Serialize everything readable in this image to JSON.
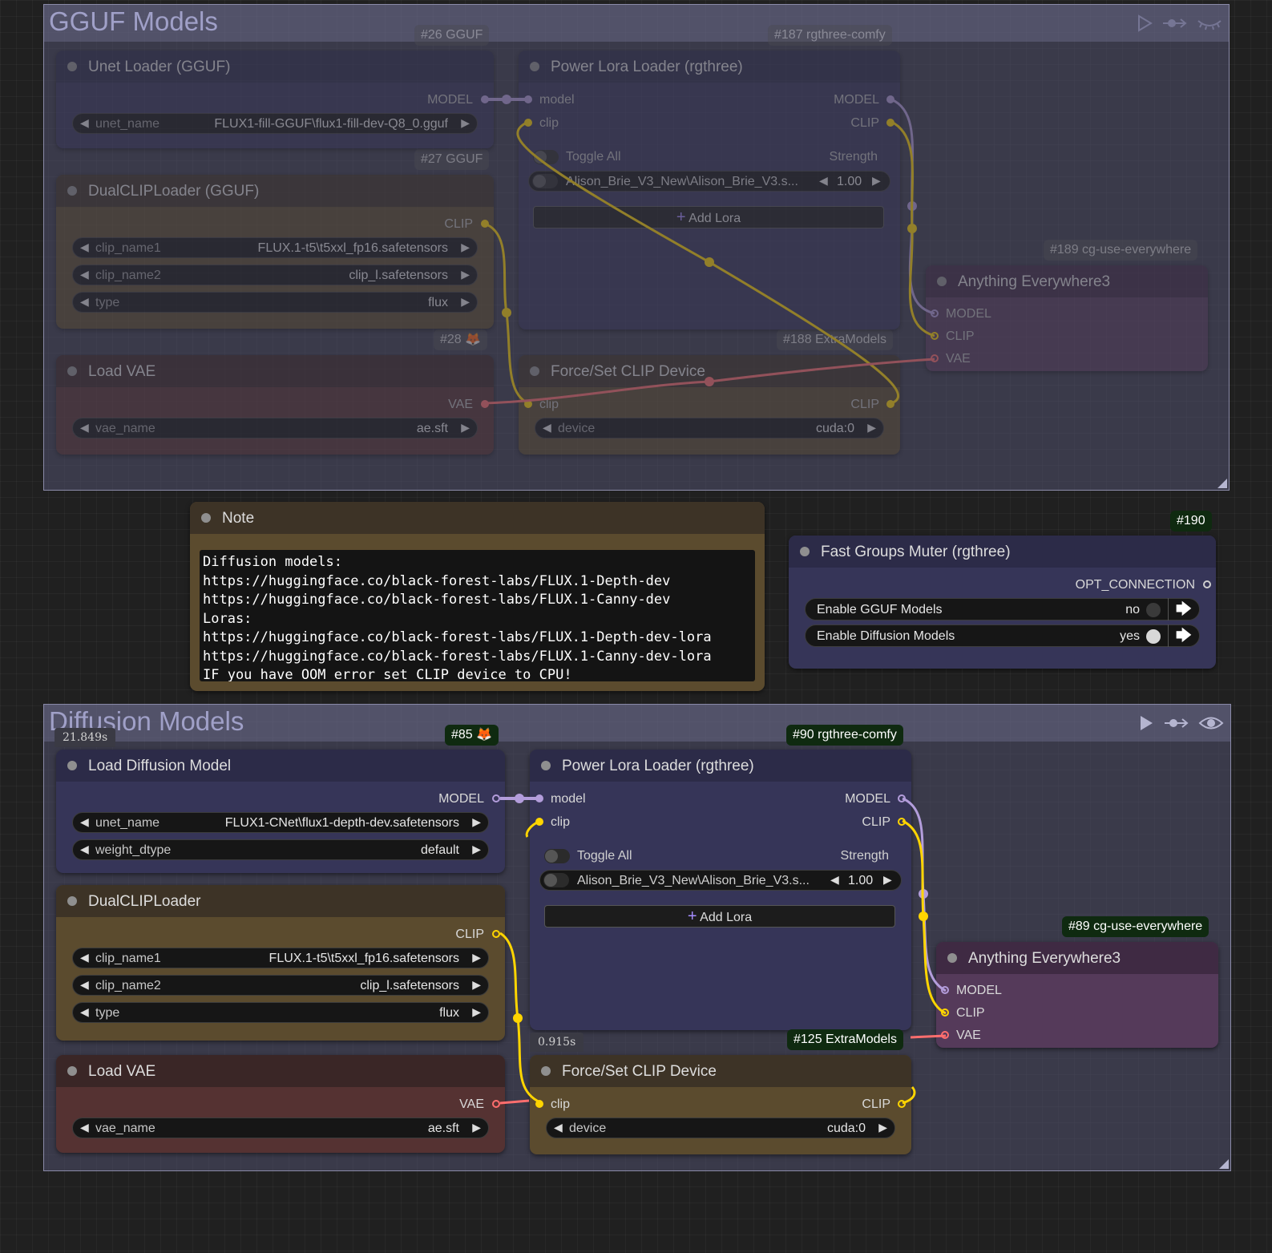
{
  "groups": {
    "gguf": {
      "title": "GGUF Models"
    },
    "diffusion": {
      "title": "Diffusion Models"
    }
  },
  "gguf": {
    "unet": {
      "badge": "#26 GGUF",
      "title": "Unet Loader (GGUF)",
      "out": "MODEL",
      "widgets": [
        {
          "name": "unet_name",
          "value": "FLUX1-fill-GGUF\\flux1-fill-dev-Q8_0.gguf"
        }
      ]
    },
    "dualclip": {
      "badge": "#27 GGUF",
      "title": "DualCLIPLoader (GGUF)",
      "out": "CLIP",
      "widgets": [
        {
          "name": "clip_name1",
          "value": "FLUX.1-t5\\t5xxl_fp16.safetensors"
        },
        {
          "name": "clip_name2",
          "value": "clip_l.safetensors"
        },
        {
          "name": "type",
          "value": "flux"
        }
      ]
    },
    "vae": {
      "badge": "#28",
      "title": "Load VAE",
      "out": "VAE",
      "widgets": [
        {
          "name": "vae_name",
          "value": "ae.sft"
        }
      ]
    },
    "lora": {
      "badge": "#187 rgthree-comfy",
      "title": "Power Lora Loader (rgthree)",
      "in_model": "model",
      "in_clip": "clip",
      "out_model": "MODEL",
      "out_clip": "CLIP",
      "toggle_all": "Toggle All",
      "strength": "Strength",
      "lora_name": "Alison_Brie_V3_New\\Alison_Brie_V3.s...",
      "lora_value": "1.00",
      "add_lora": "Add Lora"
    },
    "clipdev": {
      "badge": "#188 ExtraModels",
      "title": "Force/Set CLIP Device",
      "in_clip": "clip",
      "out_clip": "CLIP",
      "device_name": "device",
      "device_value": "cuda:0"
    },
    "anything": {
      "badge": "#189 cg-use-everywhere",
      "title": "Anything Everywhere3",
      "inputs": [
        "MODEL",
        "CLIP",
        "VAE"
      ]
    }
  },
  "note": {
    "title": "Note",
    "text": "Diffusion models:\nhttps://huggingface.co/black-forest-labs/FLUX.1-Depth-dev\nhttps://huggingface.co/black-forest-labs/FLUX.1-Canny-dev\nLoras:\nhttps://huggingface.co/black-forest-labs/FLUX.1-Depth-dev-lora\nhttps://huggingface.co/black-forest-labs/FLUX.1-Canny-dev-lora\nIF you have OOM error set CLIP device to CPU!"
  },
  "muter": {
    "badge": "#190",
    "title": "Fast Groups Muter (rgthree)",
    "out": "OPT_CONNECTION",
    "rows": [
      {
        "label": "Enable GGUF Models",
        "value": "no"
      },
      {
        "label": "Enable Diffusion Models",
        "value": "yes"
      }
    ]
  },
  "diffusion": {
    "timing_group": "21.849s",
    "unet": {
      "badge": "#85",
      "title": "Load Diffusion Model",
      "out": "MODEL",
      "widgets": [
        {
          "name": "unet_name",
          "value": "FLUX1-CNet\\flux1-depth-dev.safetensors"
        },
        {
          "name": "weight_dtype",
          "value": "default"
        }
      ]
    },
    "dualclip": {
      "title": "DualCLIPLoader",
      "out": "CLIP",
      "widgets": [
        {
          "name": "clip_name1",
          "value": "FLUX.1-t5\\t5xxl_fp16.safetensors"
        },
        {
          "name": "clip_name2",
          "value": "clip_l.safetensors"
        },
        {
          "name": "type",
          "value": "flux"
        }
      ]
    },
    "vae": {
      "title": "Load VAE",
      "out": "VAE",
      "widgets": [
        {
          "name": "vae_name",
          "value": "ae.sft"
        }
      ]
    },
    "lora": {
      "badge": "#90 rgthree-comfy",
      "title": "Power Lora Loader (rgthree)",
      "in_model": "model",
      "in_clip": "clip",
      "out_model": "MODEL",
      "out_clip": "CLIP",
      "toggle_all": "Toggle All",
      "strength": "Strength",
      "lora_name": "Alison_Brie_V3_New\\Alison_Brie_V3.s...",
      "lora_value": "1.00",
      "add_lora": "Add Lora"
    },
    "clipdev": {
      "badge": "#125 ExtraModels",
      "timing": "0.915s",
      "title": "Force/Set CLIP Device",
      "in_clip": "clip",
      "out_clip": "CLIP",
      "device_name": "device",
      "device_value": "cuda:0"
    },
    "anything": {
      "badge": "#89 cg-use-everywhere",
      "title": "Anything Everywhere3",
      "inputs": [
        "MODEL",
        "CLIP",
        "VAE"
      ]
    }
  },
  "colors": {
    "model": "#b39ddb",
    "clip": "#ffd500",
    "vae": "#ff6e6e",
    "badge": "#0f2a10"
  },
  "icons": {
    "queue": "play-icon",
    "bypass": "link-arrow-icon",
    "mute": "eye-icon",
    "fox": "fox-icon"
  }
}
